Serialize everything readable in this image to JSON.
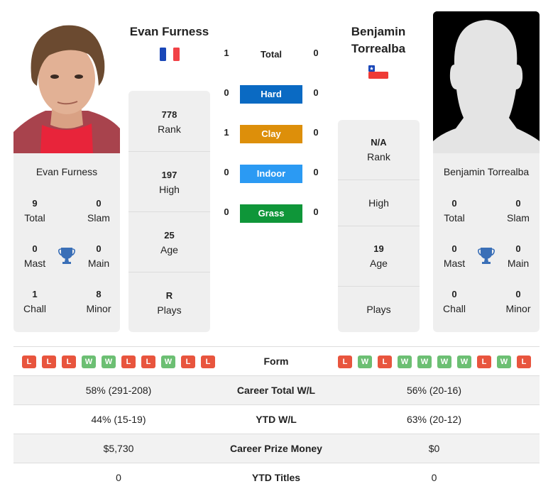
{
  "player1": {
    "name": "Evan Furness",
    "flag": "france-flag",
    "photo": "player-photo",
    "card": {
      "name": "Evan Furness",
      "titles": [
        {
          "value": "9",
          "label": "Total"
        },
        {
          "value": "0",
          "label": "Slam"
        },
        {
          "value": "0",
          "label": "Mast"
        },
        {
          "value": "0",
          "label": "Main"
        },
        {
          "value": "1",
          "label": "Chall"
        },
        {
          "value": "8",
          "label": "Minor"
        }
      ]
    },
    "stats": [
      {
        "value": "778",
        "label": "Rank"
      },
      {
        "value": "197",
        "label": "High"
      },
      {
        "value": "25",
        "label": "Age"
      },
      {
        "value": "R",
        "label": "Plays"
      }
    ],
    "form": [
      "L",
      "L",
      "L",
      "W",
      "W",
      "L",
      "L",
      "W",
      "L",
      "L"
    ]
  },
  "player2": {
    "name_line1": "Benjamin",
    "name_line2": "Torrealba",
    "flag": "chile-flag",
    "photo": "silhouette-placeholder",
    "card": {
      "name": "Benjamin Torrealba",
      "titles": [
        {
          "value": "0",
          "label": "Total"
        },
        {
          "value": "0",
          "label": "Slam"
        },
        {
          "value": "0",
          "label": "Mast"
        },
        {
          "value": "0",
          "label": "Main"
        },
        {
          "value": "0",
          "label": "Chall"
        },
        {
          "value": "0",
          "label": "Minor"
        }
      ]
    },
    "stats": [
      {
        "value": "N/A",
        "label": "Rank"
      },
      {
        "value": "",
        "label": "High"
      },
      {
        "value": "19",
        "label": "Age"
      },
      {
        "value": "",
        "label": "Plays"
      }
    ],
    "form": [
      "L",
      "W",
      "L",
      "W",
      "W",
      "W",
      "W",
      "L",
      "W",
      "L"
    ]
  },
  "h2h": [
    {
      "label": "Total",
      "p1": "1",
      "p2": "0",
      "color": ""
    },
    {
      "label": "Hard",
      "p1": "0",
      "p2": "0",
      "color": "#0a6ac3"
    },
    {
      "label": "Clay",
      "p1": "1",
      "p2": "0",
      "color": "#dd8f0a"
    },
    {
      "label": "Indoor",
      "p1": "0",
      "p2": "0",
      "color": "#2b9af3"
    },
    {
      "label": "Grass",
      "p1": "0",
      "p2": "0",
      "color": "#0f9639"
    }
  ],
  "table": {
    "form_label": "Form",
    "rows": [
      {
        "label": "Career Total W/L",
        "p1": "58% (291-208)",
        "p2": "56% (20-16)"
      },
      {
        "label": "YTD W/L",
        "p1": "44% (15-19)",
        "p2": "63% (20-12)"
      },
      {
        "label": "Career Prize Money",
        "p1": "$5,730",
        "p2": "$0"
      },
      {
        "label": "YTD Titles",
        "p1": "0",
        "p2": "0"
      }
    ]
  },
  "colors": {
    "loss": "#e8553e",
    "win": "#6cbf73",
    "trophy": "#3a6fb7",
    "card_bg": "#efefef"
  }
}
